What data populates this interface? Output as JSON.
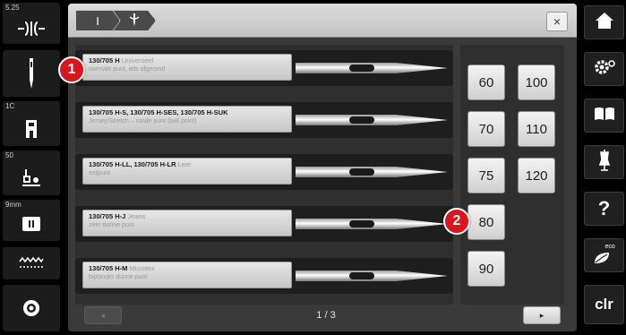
{
  "left_sidebar": {
    "items": [
      {
        "label": "5.25",
        "icon": "stitch-width-icon"
      },
      {
        "label": "",
        "icon": "needle-icon"
      },
      {
        "label": "1C",
        "icon": "presser-foot-icon"
      },
      {
        "label": "50",
        "icon": "thread-tension-icon"
      },
      {
        "label": "9mm",
        "icon": "stitch-plate-icon"
      },
      {
        "label": "",
        "icon": "stitch-pattern-icon"
      },
      {
        "label": "",
        "icon": "bobbin-icon"
      }
    ]
  },
  "topbar": {
    "breadcrumbs": [
      "I",
      "needle"
    ],
    "close_label": "×"
  },
  "needles": [
    {
      "name": "130/705 H",
      "type": "Universeel",
      "desc": "normale punt, iets afgerond"
    },
    {
      "name": "130/705 H-S, 130/705 H-SES, 130/705 H-SUK",
      "type": "",
      "desc": "Jersey/Stretch – ronde punt (ball point)"
    },
    {
      "name": "130/705 H-LL, 130/705 H-LR",
      "type": "Leer",
      "desc": "snijpunt"
    },
    {
      "name": "130/705 H-J",
      "type": "Jeans",
      "desc": "zeer dunne punt"
    },
    {
      "name": "130/705 H-M",
      "type": "Microtex",
      "desc": "bijzonder dunne punt"
    }
  ],
  "sizes": {
    "col1": [
      "60",
      "70",
      "75",
      "80",
      "90"
    ],
    "col2": [
      "100",
      "110",
      "120"
    ]
  },
  "pager": {
    "prev_label": "◂",
    "page_label": "1 / 3",
    "next_label": "▸"
  },
  "callouts": [
    "1",
    "2"
  ],
  "right_sidebar": {
    "items": [
      {
        "name": "home",
        "icon": "home-icon"
      },
      {
        "name": "setup",
        "icon": "setup-gear-icon"
      },
      {
        "name": "tutorial",
        "icon": "book-icon"
      },
      {
        "name": "sewing-consultant",
        "icon": "dress-form-icon"
      },
      {
        "name": "help",
        "icon": "help-icon",
        "label": "?"
      },
      {
        "name": "eco",
        "icon": "eco-leaf-icon",
        "label": "eco"
      },
      {
        "name": "clear",
        "icon": "clr-icon",
        "label": "clr"
      }
    ]
  },
  "colors": {
    "panel_bg": "#3a3a3a",
    "callout_red": "#d9161e",
    "button_light": "#e8e8e8"
  }
}
